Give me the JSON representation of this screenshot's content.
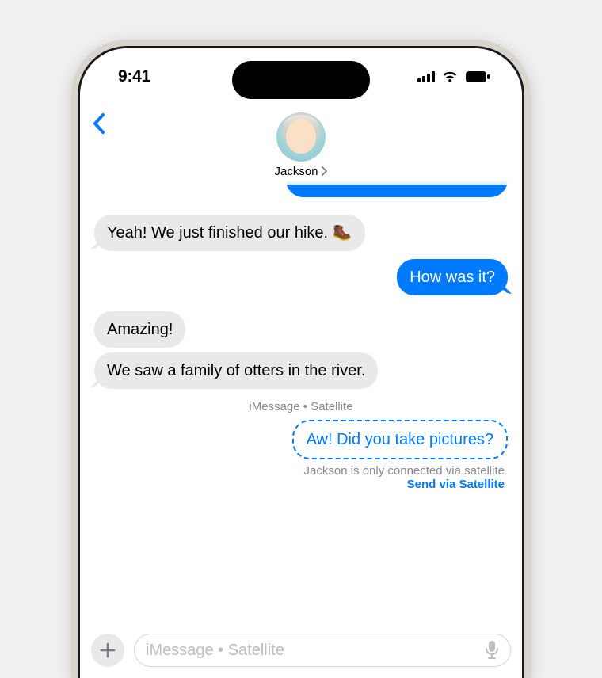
{
  "status": {
    "time": "9:41"
  },
  "contact": {
    "name": "Jackson"
  },
  "messages": {
    "m1": "Yeah! We just finished our hike. 🥾",
    "m2": "How was it?",
    "m3": "Amazing!",
    "m4": "We saw a family of otters in the river.",
    "caption": "iMessage • Satellite",
    "m5": "Aw! Did you take pictures?",
    "sat_note": "Jackson is only connected via satellite",
    "sat_link": "Send via Satellite"
  },
  "compose": {
    "placeholder": "iMessage • Satellite"
  }
}
